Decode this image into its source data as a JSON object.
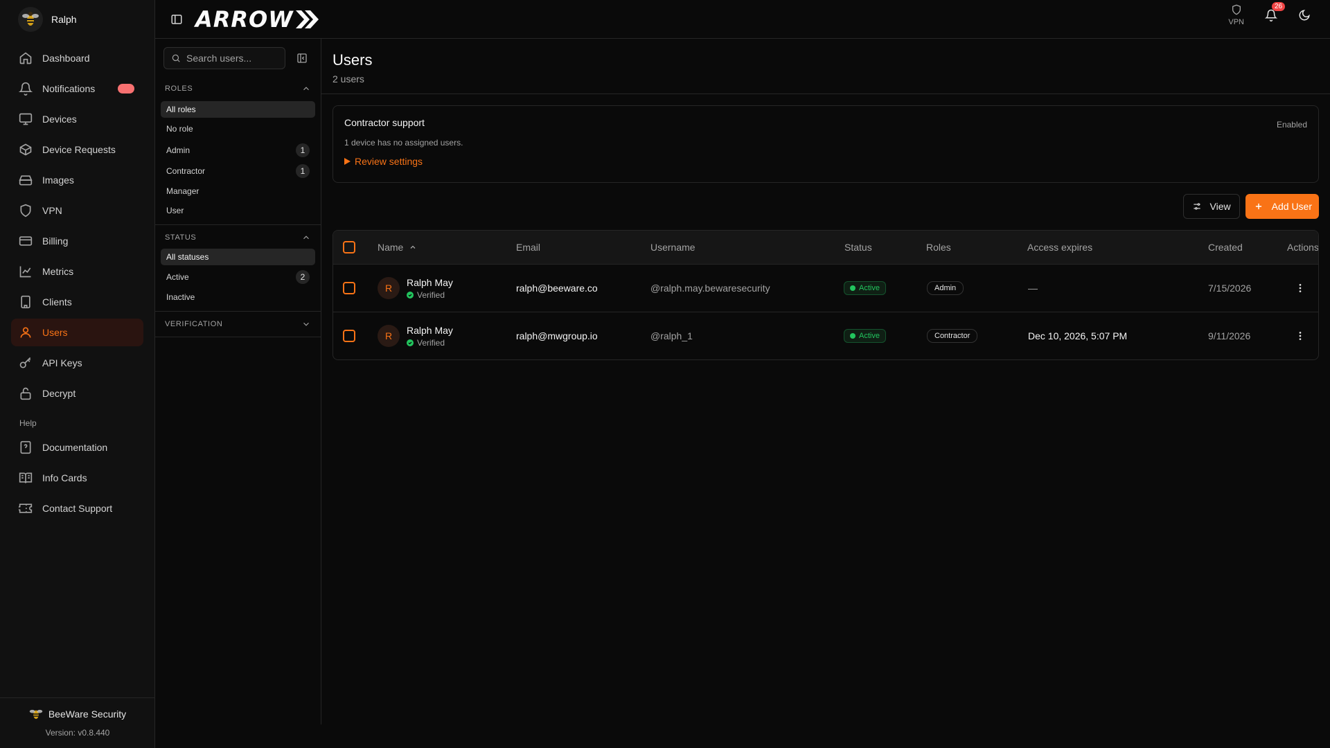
{
  "sidebar": {
    "user_name": "Ralph",
    "items": [
      {
        "label": "Dashboard",
        "icon": "home-icon"
      },
      {
        "label": "Notifications",
        "icon": "bell-icon"
      },
      {
        "label": "Devices",
        "icon": "monitor-icon"
      },
      {
        "label": "Device Requests",
        "icon": "package-icon"
      },
      {
        "label": "Images",
        "icon": "hard-drive-icon"
      },
      {
        "label": "VPN",
        "icon": "shield-icon"
      },
      {
        "label": "Billing",
        "icon": "credit-card-icon"
      },
      {
        "label": "Metrics",
        "icon": "line-chart-icon"
      },
      {
        "label": "Clients",
        "icon": "building-icon"
      },
      {
        "label": "Users",
        "icon": "user-icon"
      },
      {
        "label": "API Keys",
        "icon": "key-icon"
      },
      {
        "label": "Decrypt",
        "icon": "lock-icon"
      }
    ],
    "active_item": "Users",
    "help_label": "Help",
    "help_items": [
      {
        "label": "Documentation",
        "icon": "help-file-icon"
      },
      {
        "label": "Info Cards",
        "icon": "book-icon"
      },
      {
        "label": "Contact Support",
        "icon": "ticket-icon"
      }
    ],
    "footer": {
      "org": "BeeWare Security",
      "version": "Version: v0.8.440"
    }
  },
  "topbar": {
    "logo_text": "ARROW",
    "vpn_label": "VPN",
    "notification_count": "26"
  },
  "filters": {
    "search_placeholder": "Search users...",
    "roles_header": "ROLES",
    "roles": [
      {
        "label": "All roles",
        "count": ""
      },
      {
        "label": "No role",
        "count": ""
      },
      {
        "label": "Admin",
        "count": "1"
      },
      {
        "label": "Contractor",
        "count": "1"
      },
      {
        "label": "Manager",
        "count": ""
      },
      {
        "label": "User",
        "count": ""
      }
    ],
    "status_header": "STATUS",
    "statuses": [
      {
        "label": "All statuses",
        "count": ""
      },
      {
        "label": "Active",
        "count": "2"
      },
      {
        "label": "Inactive",
        "count": ""
      }
    ],
    "verification_header": "VERIFICATION"
  },
  "main": {
    "title": "Users",
    "subtitle": "2 users",
    "card": {
      "title": "Contractor support",
      "status": "Enabled",
      "description": "1 device has no assigned users.",
      "link": "Review settings"
    },
    "view_label": "View",
    "add_label": "Add User"
  },
  "table": {
    "headers": {
      "name": "Name",
      "email": "Email",
      "username": "Username",
      "status": "Status",
      "roles": "Roles",
      "expires": "Access expires",
      "created": "Created",
      "actions": "Actions"
    },
    "rows": [
      {
        "initial": "R",
        "name": "Ralph May",
        "verified": "Verified",
        "email": "ralph@beeware.co",
        "username": "@ralph.may.bewaresecurity",
        "status": "Active",
        "role": "Admin",
        "expires": "—",
        "created": "7/15/2026"
      },
      {
        "initial": "R",
        "name": "Ralph May",
        "verified": "Verified",
        "email": "ralph@mwgroup.io",
        "username": "@ralph_1",
        "status": "Active",
        "role": "Contractor",
        "expires": "Dec 10, 2026, 5:07 PM",
        "created": "9/11/2026"
      }
    ]
  },
  "colors": {
    "accent": "#f97316",
    "success": "#22c55e",
    "danger": "#ef4444",
    "background": "#0a0a0a"
  }
}
